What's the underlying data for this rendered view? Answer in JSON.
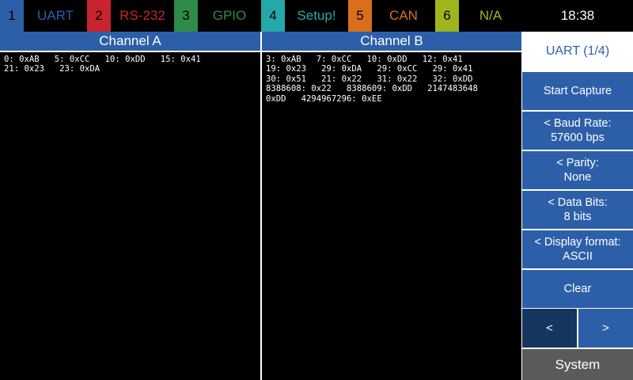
{
  "tabs": [
    {
      "num": "1",
      "label": "UART",
      "color": "#2d5fa9"
    },
    {
      "num": "2",
      "label": "RS-232",
      "color": "#c8242e"
    },
    {
      "num": "3",
      "label": "GPIO",
      "color": "#2e8b4a"
    },
    {
      "num": "4",
      "label": "Setup!",
      "color": "#27a8a8"
    },
    {
      "num": "5",
      "label": "CAN",
      "color": "#d96f1c"
    },
    {
      "num": "6",
      "label": "N/A",
      "color": "#a0b41e"
    }
  ],
  "clock": "18:38",
  "channel_a": {
    "title": "Channel A",
    "lines": [
      "0: 0xAB   5: 0xCC   10: 0xDD   15: 0x41",
      "21: 0x23   23: 0xDA"
    ]
  },
  "channel_b": {
    "title": "Channel B",
    "lines": [
      "3: 0xAB   7: 0xCC   10: 0xDD   12: 0x41",
      "19: 0x23   29: 0xDA   29: 0xCC   29: 0x41",
      "30: 0x51   21: 0x22   31: 0x22   32: 0xDD",
      "8388608: 0x22   8388609: 0xDD   2147483648",
      "0xDD   4294967296: 0xEE"
    ]
  },
  "menu": {
    "title": "UART (1/4)",
    "start_capture": "Start Capture",
    "baud": {
      "label": "< Baud Rate:",
      "value": "57600 bps"
    },
    "parity": {
      "label": "< Parity:",
      "value": "None"
    },
    "data_bits": {
      "label": "< Data Bits:",
      "value": "8 bits"
    },
    "display_format": {
      "label": "< Display format:",
      "value": "ASCII"
    },
    "clear": "Clear",
    "prev": "<",
    "next": ">",
    "system": "System"
  }
}
